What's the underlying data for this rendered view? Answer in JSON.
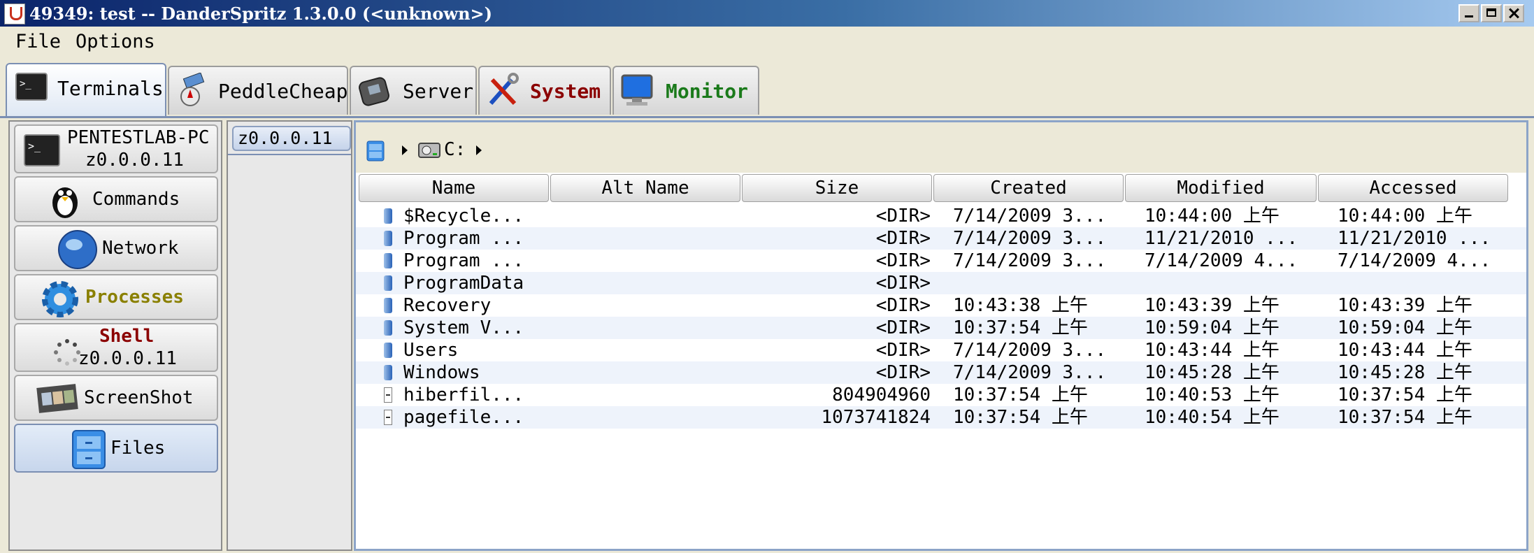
{
  "window": {
    "title": "49349: test -- DanderSpritz 1.3.0.0 (<unknown>)"
  },
  "menu": [
    "File",
    "Options"
  ],
  "top_tabs": [
    {
      "label": "Terminals",
      "icon": "terminal-icon",
      "color": "#000000"
    },
    {
      "label": "PeddleCheap",
      "icon": "satellite-compass-icon",
      "color": "#000000"
    },
    {
      "label": "Server",
      "icon": "phone-icon",
      "color": "#000000"
    },
    {
      "label": "System",
      "icon": "tools-icon",
      "color": "#8b0000"
    },
    {
      "label": "Monitor",
      "icon": "monitor-icon",
      "color": "#1a7a1a"
    }
  ],
  "sidebar": {
    "host": {
      "name": "PENTESTLAB-PC",
      "address": "z0.0.0.11"
    },
    "items": [
      {
        "label": "Commands",
        "icon": "penguin-icon",
        "color": "#000000"
      },
      {
        "label": "Network",
        "icon": "globe-icon",
        "color": "#000000"
      },
      {
        "label": "Processes",
        "icon": "gear-icon",
        "color": "#8a8000"
      },
      {
        "label": "Shell",
        "sub": "z0.0.0.11",
        "icon": "spinner-icon",
        "color": "#8b0000"
      },
      {
        "label": "ScreenShot",
        "icon": "film-icon",
        "color": "#000000"
      },
      {
        "label": "Files",
        "icon": "file-cabinet-icon",
        "color": "#000000"
      }
    ]
  },
  "target_tab": "z0.0.0.11",
  "path": {
    "drive": "C:"
  },
  "table": {
    "columns": [
      "Name",
      "Alt Name",
      "Size",
      "Created",
      "Modified",
      "Accessed"
    ],
    "rows": [
      {
        "type": "folder",
        "name": "$Recycle...",
        "alt": "",
        "size": "<DIR>",
        "created": "7/14/2009 3...",
        "modified": "10:44:00 上午",
        "accessed": "10:44:00 上午"
      },
      {
        "type": "folder",
        "name": "Program ...",
        "alt": "",
        "size": "<DIR>",
        "created": "7/14/2009 3...",
        "modified": "11/21/2010 ...",
        "accessed": "11/21/2010 ..."
      },
      {
        "type": "folder",
        "name": "Program ...",
        "alt": "",
        "size": "<DIR>",
        "created": "7/14/2009 3...",
        "modified": "7/14/2009 4...",
        "accessed": "7/14/2009 4..."
      },
      {
        "type": "folder",
        "name": "ProgramData",
        "alt": "",
        "size": "<DIR>",
        "created": "",
        "modified": "",
        "accessed": ""
      },
      {
        "type": "folder",
        "name": "Recovery",
        "alt": "",
        "size": "<DIR>",
        "created": "10:43:38 上午",
        "modified": "10:43:39 上午",
        "accessed": "10:43:39 上午"
      },
      {
        "type": "folder",
        "name": "System V...",
        "alt": "",
        "size": "<DIR>",
        "created": "10:37:54 上午",
        "modified": "10:59:04 上午",
        "accessed": "10:59:04 上午"
      },
      {
        "type": "folder",
        "name": "Users",
        "alt": "",
        "size": "<DIR>",
        "created": "7/14/2009 3...",
        "modified": "10:43:44 上午",
        "accessed": "10:43:44 上午"
      },
      {
        "type": "folder",
        "name": "Windows",
        "alt": "",
        "size": "<DIR>",
        "created": "7/14/2009 3...",
        "modified": "10:45:28 上午",
        "accessed": "10:45:28 上午"
      },
      {
        "type": "file",
        "name": "hiberfil...",
        "alt": "",
        "size": "804904960",
        "created": "10:37:54 上午",
        "modified": "10:40:53 上午",
        "accessed": "10:37:54 上午"
      },
      {
        "type": "file",
        "name": "pagefile...",
        "alt": "",
        "size": "1073741824",
        "created": "10:37:54 上午",
        "modified": "10:40:54 上午",
        "accessed": "10:37:54 上午"
      }
    ]
  }
}
